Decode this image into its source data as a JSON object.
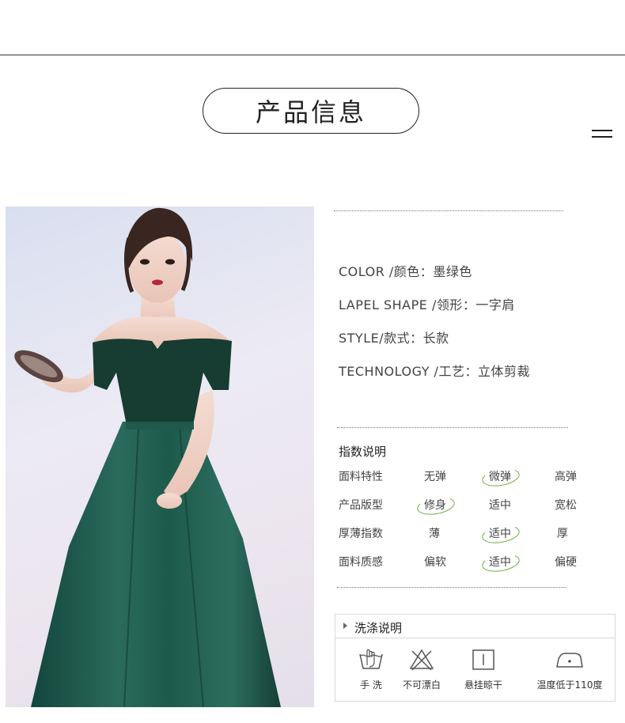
{
  "header": {
    "title": "产品信息"
  },
  "specs": [
    {
      "label": "COLOR /颜色：",
      "value": "墨绿色"
    },
    {
      "label": "LAPEL SHAPE /领形：",
      "value": "一字肩"
    },
    {
      "label": "STYLE/款式：",
      "value": "长款"
    },
    {
      "label": "TECHNOLOGY /工艺：",
      "value": "立体剪裁"
    }
  ],
  "index": {
    "title": "指数说明",
    "rows": [
      {
        "name": "面料特性",
        "options": [
          "无弹",
          "微弹",
          "高弹"
        ],
        "selected": 1
      },
      {
        "name": "产品版型",
        "options": [
          "修身",
          "适中",
          "宽松"
        ],
        "selected": 0
      },
      {
        "name": "厚薄指数",
        "options": [
          "薄",
          "适中",
          "厚"
        ],
        "selected": 1
      },
      {
        "name": "面料质感",
        "options": [
          "偏软",
          "适中",
          "偏硬"
        ],
        "selected": 1
      }
    ],
    "highlight_color": "#6aaa3a"
  },
  "wash": {
    "title": "洗涤说明",
    "items": [
      {
        "icon": "hand-wash-icon",
        "label": "手 洗"
      },
      {
        "icon": "no-bleach-icon",
        "label": "不可漂白"
      },
      {
        "icon": "hang-dry-icon",
        "label": "悬挂晾干"
      },
      {
        "icon": "iron-low-icon",
        "label": "温度低于110度"
      }
    ]
  },
  "colors": {
    "dress_green": "#1f5a4d",
    "velvet_green": "#173c31"
  }
}
